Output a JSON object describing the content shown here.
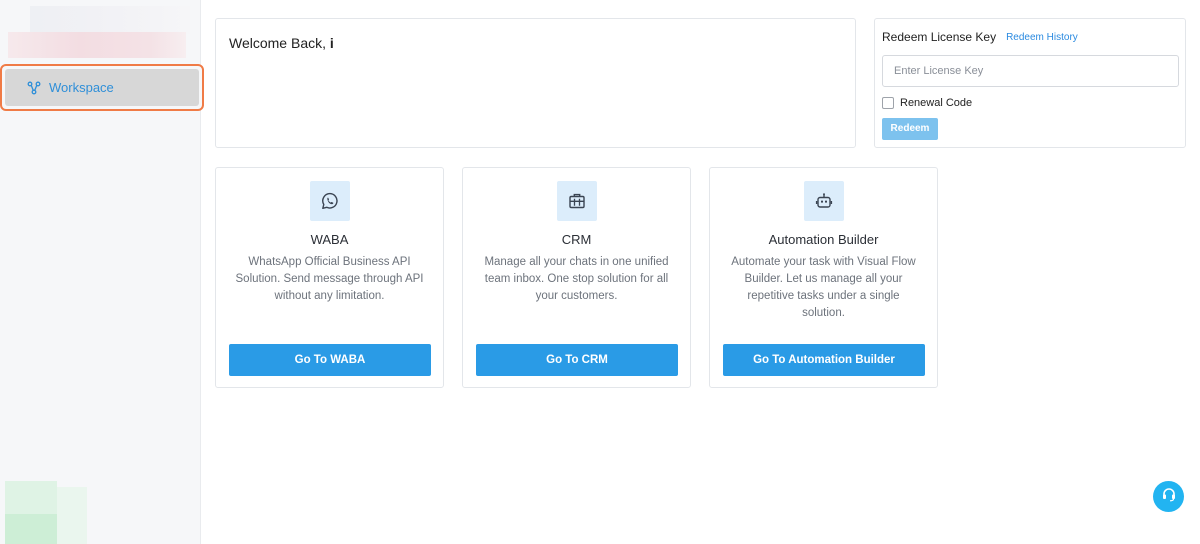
{
  "sidebar": {
    "nav": [
      {
        "label": "Workspace",
        "icon": "workspace-icon"
      }
    ]
  },
  "welcome": {
    "greeting": "Welcome Back,",
    "name": "i"
  },
  "redeem": {
    "title": "Redeem License Key",
    "history_link": "Redeem History",
    "placeholder": "Enter License Key",
    "renewal_label": "Renewal Code",
    "button": "Redeem"
  },
  "cards": [
    {
      "title": "WABA",
      "icon": "whatsapp-icon",
      "desc": "WhatsApp Official Business API Solution. Send message through API without any limitation.",
      "button": "Go To WABA"
    },
    {
      "title": "CRM",
      "icon": "crm-icon",
      "desc": "Manage all your chats in one unified team inbox. One stop solution for all your customers.",
      "button": "Go To CRM"
    },
    {
      "title": "Automation Builder",
      "icon": "robot-icon",
      "desc": "Automate your task with Visual Flow Builder. Let us manage all your repetitive tasks under a single solution.",
      "button": "Go To Automation Builder"
    }
  ],
  "colors": {
    "accent": "#2a9be6",
    "active_outline": "#f07b46",
    "icon_bg": "#dcedfb"
  }
}
